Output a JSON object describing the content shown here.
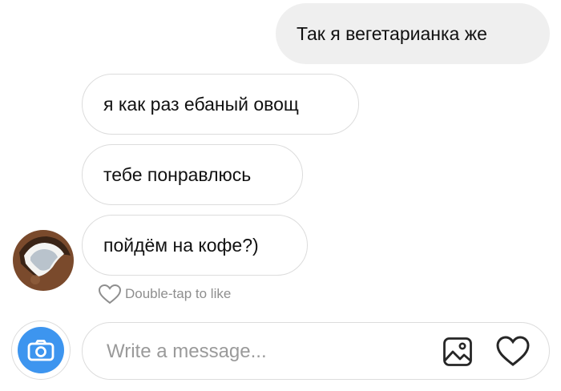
{
  "messages": [
    {
      "direction": "sent",
      "text": "Так я вегетарианка же"
    },
    {
      "direction": "received",
      "text": "я как раз ебаный овощ"
    },
    {
      "direction": "received",
      "text": "тебе понравлюсь"
    },
    {
      "direction": "received",
      "text": "пойдём на кофе?)"
    }
  ],
  "like_hint": {
    "text": "Double-tap to like",
    "icon": "heart-outline-icon"
  },
  "avatar": {
    "icon": "coconut-avatar"
  },
  "composer": {
    "placeholder": "Write a message...",
    "value": "",
    "camera_icon": "camera-icon",
    "gallery_icon": "image-icon",
    "like_icon": "heart-icon"
  },
  "colors": {
    "sent_bubble": "#efefef",
    "received_border": "#dcdcdc",
    "camera_accent": "#3d95ef",
    "hint_text": "#8e8e8e"
  }
}
